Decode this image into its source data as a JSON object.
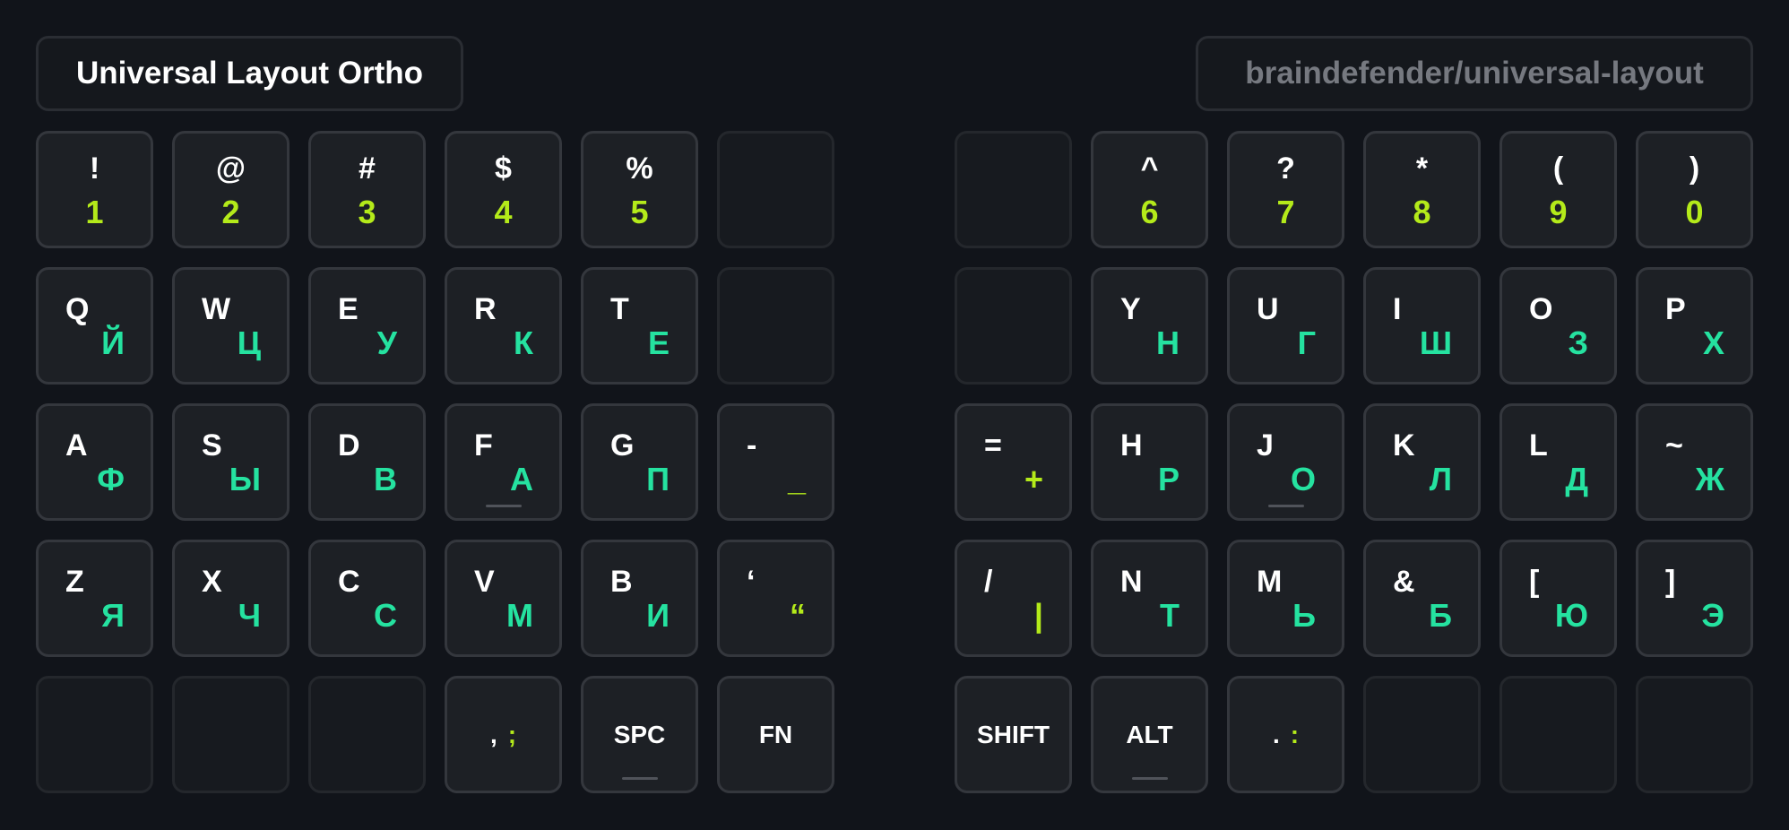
{
  "header": {
    "title": "Universal Layout Ortho",
    "repo": "braindefender/universal-layout"
  },
  "colors": {
    "background": "#11141a",
    "key": "#1d2025",
    "primary_text": "#ffffff",
    "cyrillic": "#25e2a0",
    "symbol": "#b4ea1a",
    "alt": "#f01b5e",
    "muted": "#767980"
  },
  "left": {
    "num": [
      {
        "shift": "!",
        "base": "1"
      },
      {
        "shift": "@",
        "base": "2"
      },
      {
        "shift": "#",
        "base": "3"
      },
      {
        "shift": "$",
        "base": "4"
      },
      {
        "shift": "%",
        "base": "5"
      }
    ],
    "top": [
      {
        "en": "Q",
        "ru": "Й"
      },
      {
        "en": "W",
        "ru": "Ц"
      },
      {
        "en": "E",
        "ru": "У"
      },
      {
        "en": "R",
        "ru": "К"
      },
      {
        "en": "T",
        "ru": "Е"
      }
    ],
    "home": [
      {
        "en": "A",
        "ru": "Ф"
      },
      {
        "en": "S",
        "ru": "Ы"
      },
      {
        "en": "D",
        "ru": "В"
      },
      {
        "en": "F",
        "ru": "А"
      },
      {
        "en": "G",
        "ru": "П"
      },
      {
        "en": "-",
        "ru": "_"
      }
    ],
    "bottom": [
      {
        "en": "Z",
        "ru": "Я"
      },
      {
        "en": "X",
        "ru": "Ч"
      },
      {
        "en": "C",
        "ru": "С"
      },
      {
        "en": "V",
        "ru": "М"
      },
      {
        "en": "B",
        "ru": "И"
      },
      {
        "en": "‘",
        "ru": "“"
      }
    ],
    "thumbs": {
      "comma": {
        "a": ",",
        "b": ";"
      },
      "space": "SPC",
      "fn": "FN"
    }
  },
  "right": {
    "num": [
      {
        "shift": "^",
        "base": "6"
      },
      {
        "shift": "?",
        "base": "7"
      },
      {
        "shift": "*",
        "base": "8"
      },
      {
        "shift": "(",
        "base": "9"
      },
      {
        "shift": ")",
        "base": "0"
      }
    ],
    "top": [
      {
        "en": "Y",
        "ru": "Н"
      },
      {
        "en": "U",
        "ru": "Г"
      },
      {
        "en": "I",
        "ru": "Ш"
      },
      {
        "en": "O",
        "ru": "З"
      },
      {
        "en": "P",
        "ru": "Х"
      }
    ],
    "home": [
      {
        "en": "=",
        "ru": "+"
      },
      {
        "en": "H",
        "ru": "Р"
      },
      {
        "en": "J",
        "ru": "О"
      },
      {
        "en": "K",
        "ru": "Л"
      },
      {
        "en": "L",
        "ru": "Д"
      },
      {
        "en": "~",
        "ru": "Ж"
      }
    ],
    "bottom": [
      {
        "en": "/",
        "ru": "|"
      },
      {
        "en": "N",
        "ru": "Т"
      },
      {
        "en": "M",
        "ru": "Ь"
      },
      {
        "en": "&",
        "ru": "Б"
      },
      {
        "en": "[",
        "ru": "Ю"
      },
      {
        "en": "]",
        "ru": "Э"
      }
    ],
    "thumbs": {
      "shift": "SHIFT",
      "alt": "ALT",
      "period": {
        "a": ".",
        "b": ":"
      }
    }
  }
}
